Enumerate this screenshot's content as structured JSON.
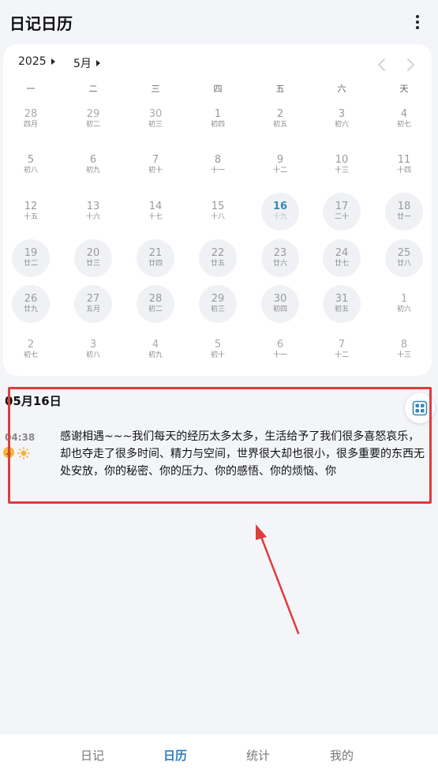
{
  "app": {
    "title": "日记日历"
  },
  "calendar": {
    "year_label": "2025",
    "month_label": "5月",
    "weekdays": [
      "一",
      "二",
      "三",
      "四",
      "五",
      "六",
      "天"
    ],
    "selected_day": "16",
    "weeks": [
      [
        {
          "day": "28",
          "lunar": "四月",
          "filled": false,
          "other": true
        },
        {
          "day": "29",
          "lunar": "初二",
          "filled": false,
          "other": true
        },
        {
          "day": "30",
          "lunar": "初三",
          "filled": false,
          "other": true
        },
        {
          "day": "1",
          "lunar": "初四",
          "filled": false,
          "other": false
        },
        {
          "day": "2",
          "lunar": "初五",
          "filled": false,
          "other": false
        },
        {
          "day": "3",
          "lunar": "初六",
          "filled": false,
          "other": false
        },
        {
          "day": "4",
          "lunar": "初七",
          "filled": false,
          "other": false
        }
      ],
      [
        {
          "day": "5",
          "lunar": "初八",
          "filled": false,
          "other": false
        },
        {
          "day": "6",
          "lunar": "初九",
          "filled": false,
          "other": false
        },
        {
          "day": "7",
          "lunar": "初十",
          "filled": false,
          "other": false
        },
        {
          "day": "8",
          "lunar": "十一",
          "filled": false,
          "other": false
        },
        {
          "day": "9",
          "lunar": "十二",
          "filled": false,
          "other": false
        },
        {
          "day": "10",
          "lunar": "十三",
          "filled": false,
          "other": false
        },
        {
          "day": "11",
          "lunar": "十四",
          "filled": false,
          "other": false
        }
      ],
      [
        {
          "day": "12",
          "lunar": "十五",
          "filled": false,
          "other": false
        },
        {
          "day": "13",
          "lunar": "十六",
          "filled": false,
          "other": false
        },
        {
          "day": "14",
          "lunar": "十七",
          "filled": false,
          "other": false
        },
        {
          "day": "15",
          "lunar": "十八",
          "filled": false,
          "other": false
        },
        {
          "day": "16",
          "lunar": "十九",
          "filled": true,
          "other": false,
          "today": true
        },
        {
          "day": "17",
          "lunar": "二十",
          "filled": true,
          "other": false
        },
        {
          "day": "18",
          "lunar": "廿一",
          "filled": true,
          "other": false
        }
      ],
      [
        {
          "day": "19",
          "lunar": "廿二",
          "filled": true,
          "other": false
        },
        {
          "day": "20",
          "lunar": "廿三",
          "filled": true,
          "other": false
        },
        {
          "day": "21",
          "lunar": "廿四",
          "filled": true,
          "other": false
        },
        {
          "day": "22",
          "lunar": "廿五",
          "filled": true,
          "other": false
        },
        {
          "day": "23",
          "lunar": "廿六",
          "filled": true,
          "other": false
        },
        {
          "day": "24",
          "lunar": "廿七",
          "filled": true,
          "other": false
        },
        {
          "day": "25",
          "lunar": "廿八",
          "filled": true,
          "other": false
        }
      ],
      [
        {
          "day": "26",
          "lunar": "廿九",
          "filled": true,
          "other": false
        },
        {
          "day": "27",
          "lunar": "五月",
          "filled": true,
          "other": false
        },
        {
          "day": "28",
          "lunar": "初二",
          "filled": true,
          "other": false
        },
        {
          "day": "29",
          "lunar": "初三",
          "filled": true,
          "other": false
        },
        {
          "day": "30",
          "lunar": "初四",
          "filled": true,
          "other": false
        },
        {
          "day": "31",
          "lunar": "初五",
          "filled": true,
          "other": false
        },
        {
          "day": "1",
          "lunar": "初六",
          "filled": false,
          "other": true
        }
      ],
      [
        {
          "day": "2",
          "lunar": "初七",
          "filled": false,
          "other": true
        },
        {
          "day": "3",
          "lunar": "初八",
          "filled": false,
          "other": true
        },
        {
          "day": "4",
          "lunar": "初九",
          "filled": false,
          "other": true
        },
        {
          "day": "5",
          "lunar": "初十",
          "filled": false,
          "other": true
        },
        {
          "day": "6",
          "lunar": "十一",
          "filled": false,
          "other": true
        },
        {
          "day": "7",
          "lunar": "十二",
          "filled": false,
          "other": true
        },
        {
          "day": "8",
          "lunar": "十三",
          "filled": false,
          "other": true
        }
      ]
    ]
  },
  "diary": {
    "date_title": "05月16日",
    "entries": [
      {
        "time": "04:38",
        "mood_icon": "smiley-icon",
        "weather_icon": "sun-icon",
        "text": "感谢相遇~~~我们每天的经历太多太多，生活给予了我们很多喜怒哀乐，却也夺走了很多时间、精力与空间，世界很大却也很小，很多重要的东西无处安放，你的秘密、你的压力、你的感悟、你的烦恼、你"
      }
    ]
  },
  "tabs": [
    {
      "label": "日记",
      "active": false
    },
    {
      "label": "日历",
      "active": true
    },
    {
      "label": "统计",
      "active": false
    },
    {
      "label": "我的",
      "active": false
    }
  ],
  "colors": {
    "accent": "#2a7fc0",
    "today": "#3a88b8",
    "highlight": "#e03c3c",
    "background": "#f3f5f9"
  }
}
